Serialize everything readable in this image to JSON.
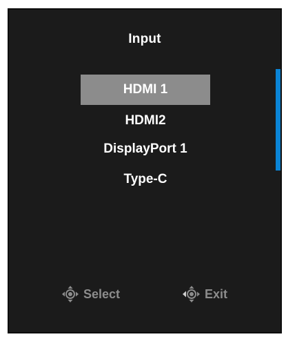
{
  "osd": {
    "title": "Input",
    "options": [
      {
        "label": "HDMI 1",
        "selected": true
      },
      {
        "label": "HDMI2",
        "selected": false
      },
      {
        "label": "DisplayPort 1",
        "selected": false
      },
      {
        "label": "Type-C",
        "selected": false
      }
    ],
    "footer": {
      "select_label": "Select",
      "select_icon": "joystick-press-icon",
      "exit_label": "Exit",
      "exit_icon": "joystick-left-icon"
    }
  },
  "colors": {
    "panel_background": "#1b1b1b",
    "selected_highlight": "#8c8c8c",
    "scrollbar_accent": "#0a84d6",
    "hint_text": "#8c8c8c"
  }
}
